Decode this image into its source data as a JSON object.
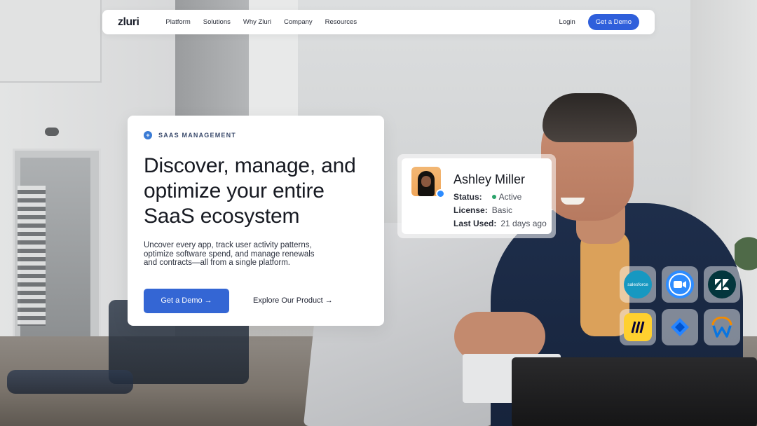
{
  "nav": {
    "logo": "zluri",
    "links": [
      "Platform",
      "Solutions",
      "Why Zluri",
      "Company",
      "Resources"
    ],
    "login": "Login",
    "cta": "Get a Demo"
  },
  "hero": {
    "badge": "SAAS MANAGEMENT",
    "headline_lines": [
      "Discover, manage, and",
      "optimize your entire",
      "SaaS ecosystem"
    ],
    "description_lines": [
      "Uncover every app, track user activity patterns,",
      "optimize software spend, and manage renewals",
      "and contracts—all from a single platform."
    ],
    "primary_cta": "Get a Demo →",
    "secondary_cta": "Explore Our Product →"
  },
  "profile": {
    "name": "Ashley Miller",
    "status_label": "Status:",
    "status_value": "Active",
    "license_label": "License:",
    "license_value": "Basic",
    "last_used_label": "Last Used:",
    "last_used_value": "21 days ago"
  },
  "apps": [
    {
      "icon": "salesforce-icon",
      "label": "salesforce",
      "color": "#1798c1"
    },
    {
      "icon": "zoom-icon",
      "label": "",
      "color": "#2d8cff"
    },
    {
      "icon": "zendesk-icon",
      "label": "",
      "color": "#03363d"
    },
    {
      "icon": "miro-icon",
      "label": "",
      "color": "#ffd02f"
    },
    {
      "icon": "jira-icon",
      "label": "",
      "color": "#2684ff"
    },
    {
      "icon": "workday-icon",
      "label": "",
      "color": "#0875e1"
    }
  ],
  "colors": {
    "primary": "#3466d4",
    "active": "#2aa36a"
  }
}
